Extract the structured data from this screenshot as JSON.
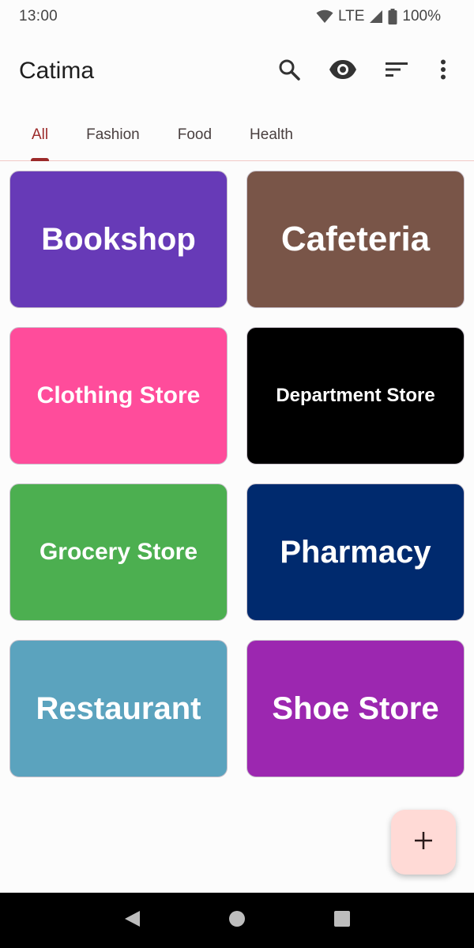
{
  "status_bar": {
    "time": "13:00",
    "network": "LTE",
    "battery": "100%",
    "icons": [
      "wifi-icon",
      "signal-icon",
      "battery-icon"
    ]
  },
  "app_bar": {
    "title": "Catima",
    "actions": [
      "search-icon",
      "eye-icon",
      "sort-icon",
      "more-vert-icon"
    ]
  },
  "tabs": [
    {
      "label": "All",
      "active": true
    },
    {
      "label": "Fashion",
      "active": false
    },
    {
      "label": "Food",
      "active": false
    },
    {
      "label": "Health",
      "active": false
    }
  ],
  "cards": [
    {
      "label": "Bookshop",
      "color": "#673ab7"
    },
    {
      "label": "Cafeteria",
      "color": "#795548"
    },
    {
      "label": "Clothing Store",
      "color": "#ff4c9b"
    },
    {
      "label": "Department Store",
      "color": "#000000"
    },
    {
      "label": "Grocery Store",
      "color": "#4caf50"
    },
    {
      "label": "Pharmacy",
      "color": "#002a6e"
    },
    {
      "label": "Restaurant",
      "color": "#5ba3be"
    },
    {
      "label": "Shoe Store",
      "color": "#9c27b0"
    }
  ],
  "fab": {
    "icon": "plus-icon",
    "color": "#ffdad6"
  },
  "nav_bar": {
    "icons": [
      "back-icon",
      "home-icon",
      "recents-icon"
    ]
  },
  "colors": {
    "accent": "#9c2a2a",
    "tab_divider": "#f1c9c7"
  }
}
